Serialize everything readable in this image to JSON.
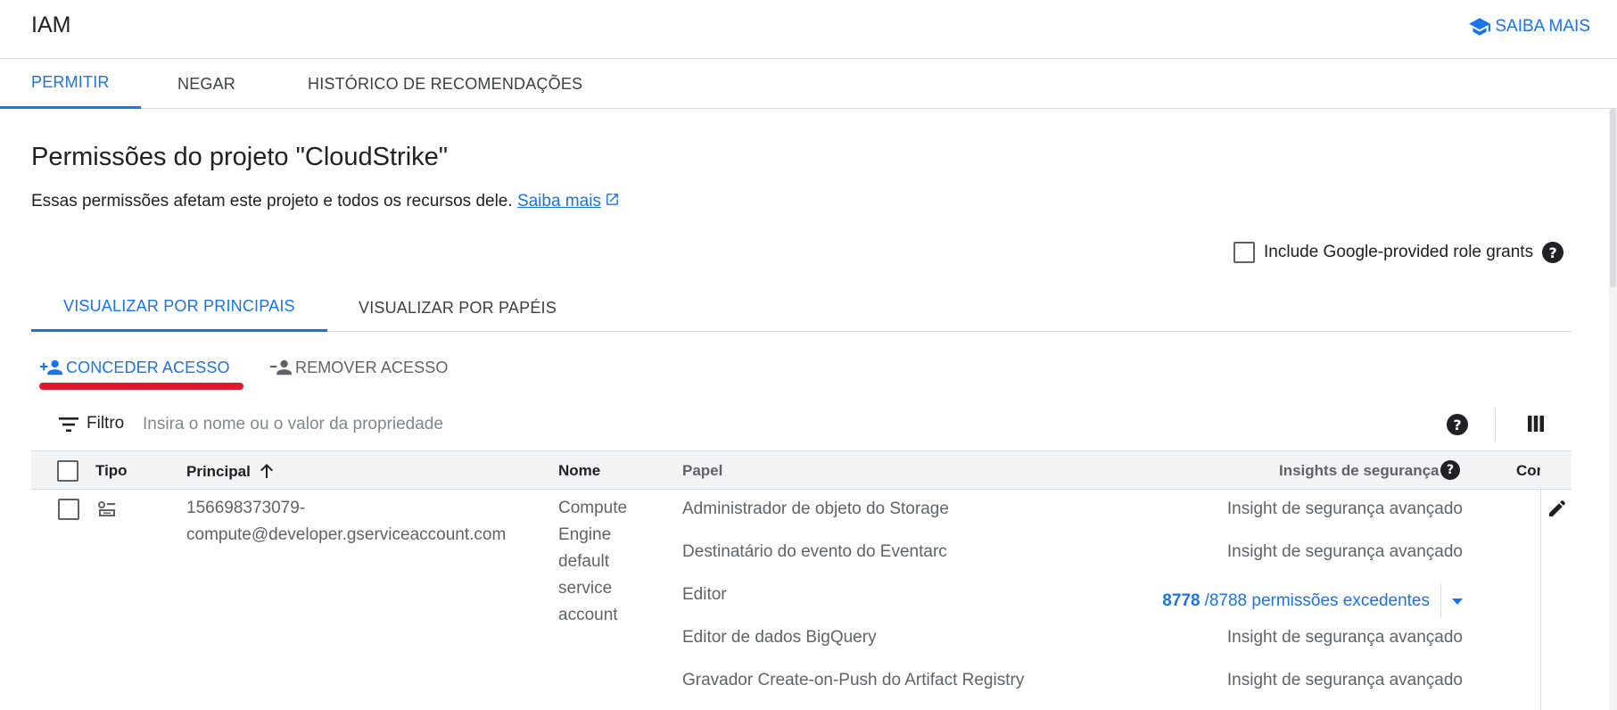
{
  "app": {
    "title": "IAM",
    "learn_more": "SAIBA MAIS"
  },
  "main_tabs": [
    {
      "label": "PERMITIR",
      "active": true
    },
    {
      "label": "NEGAR",
      "active": false
    },
    {
      "label": "HISTÓRICO DE RECOMENDAÇÕES",
      "active": false
    }
  ],
  "page": {
    "title": "Permissões do projeto \"CloudStrike\"",
    "description": "Essas permissões afetam este projeto e todos os recursos dele.",
    "learn_more_link": "Saiba mais",
    "include_google_grants": "Include Google-provided role grants"
  },
  "view_tabs": [
    {
      "label": "VISUALIZAR POR PRINCIPAIS",
      "active": true
    },
    {
      "label": "VISUALIZAR POR PAPÉIS",
      "active": false
    }
  ],
  "actions": {
    "grant": "CONCEDER ACESSO",
    "remove": "REMOVER ACESSO"
  },
  "filter": {
    "label": "Filtro",
    "placeholder": "Insira o nome ou o valor da propriedade"
  },
  "table": {
    "headers": {
      "type": "Tipo",
      "principal": "Principal",
      "name": "Nome",
      "role": "Papel",
      "insights": "Insights de segurança",
      "condition": "Cor"
    },
    "row": {
      "principal_line1": "156698373079-",
      "principal_line2": "compute@developer.gserviceaccount.com",
      "name_lines": [
        "Compute",
        "Engine",
        "default",
        "service",
        "account"
      ],
      "roles": [
        {
          "role": "Administrador de objeto do Storage",
          "insight": "Insight de segurança avançado"
        },
        {
          "role": "Destinatário do evento do Eventarc",
          "insight": "Insight de segurança avançado"
        },
        {
          "role": "Editor",
          "insight": ""
        },
        {
          "role": "Editor de dados BigQuery",
          "insight": "Insight de segurança avançado"
        },
        {
          "role": "Gravador Create-on-Push do Artifact Registry",
          "insight": "Insight de segurança avançado"
        }
      ],
      "excess": {
        "count": "8778",
        "text": "/8788 permissões excedentes"
      }
    }
  },
  "colors": {
    "accent": "#1a73e8",
    "annotation": "#e3172d"
  }
}
